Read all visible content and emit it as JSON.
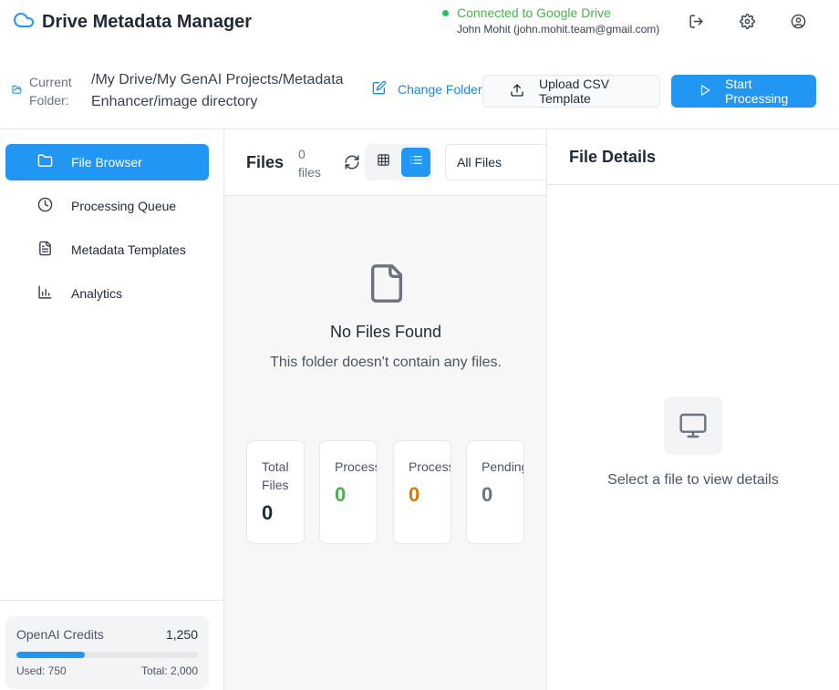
{
  "app": {
    "title": "Drive Metadata Manager"
  },
  "connection": {
    "status": "Connected to Google Drive",
    "user": "John Mohit (john.mohit.team@gmail.com)"
  },
  "header_icons": [
    "logout-icon",
    "settings-icon",
    "account-icon"
  ],
  "folder": {
    "label": "Current Folder:",
    "path": "/My Drive/My GenAI Projects/Metadata Enhancer/image directory",
    "change_label": "Change Folder"
  },
  "actions": {
    "upload_label": "Upload CSV Template",
    "start_label": "Start Processing"
  },
  "sidebar": {
    "items": [
      {
        "label": "File Browser",
        "icon": "folder-icon",
        "active": true
      },
      {
        "label": "Processing Queue",
        "icon": "clock-icon",
        "active": false
      },
      {
        "label": "Metadata Templates",
        "icon": "document-icon",
        "active": false
      },
      {
        "label": "Analytics",
        "icon": "bar-chart-icon",
        "active": false
      }
    ]
  },
  "credits": {
    "label": "OpenAI Credits",
    "value": "1,250",
    "used_label": "Used: 750",
    "total_label": "Total: 2,000",
    "used_fraction": 0.375
  },
  "files": {
    "title": "Files",
    "count_label": "0 files",
    "filter_value": "All Files",
    "empty_title": "No Files Found",
    "empty_subtitle": "This folder doesn't contain any files.",
    "stats": [
      {
        "label": "Total Files",
        "value": "0",
        "color": "#1f2937"
      },
      {
        "label": "Processed",
        "value": "0",
        "color": "#4caf50"
      },
      {
        "label": "Processing",
        "value": "0",
        "color": "#d97706"
      },
      {
        "label": "Pending",
        "value": "0",
        "color": "#6b7280"
      }
    ]
  },
  "details": {
    "title": "File Details",
    "empty_message": "Select a file to view details"
  },
  "colors": {
    "accent": "#2196f3",
    "connected": "#4caf50"
  }
}
